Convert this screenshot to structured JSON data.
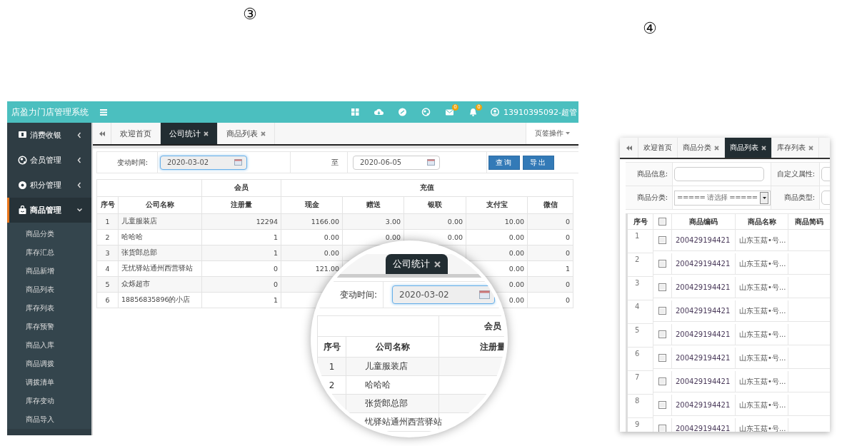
{
  "company_stats_screen": {
    "number": "③",
    "app_title": "店盈力门店管理系统",
    "mail_badge": "0",
    "bell_badge": "0",
    "user": "13910395092-超管",
    "sidebar": [
      {
        "label": "消费收银",
        "kind": "cashier",
        "expanded": false,
        "selected": false
      },
      {
        "label": "会员管理",
        "kind": "member",
        "expanded": false,
        "selected": false
      },
      {
        "label": "积分管理",
        "kind": "points",
        "expanded": false,
        "selected": false
      },
      {
        "label": "商品管理",
        "kind": "goods",
        "expanded": true,
        "selected": true,
        "children": [
          {
            "label": "商品分类"
          },
          {
            "label": "库存汇总"
          },
          {
            "label": "商品新增"
          },
          {
            "label": "商品列表"
          },
          {
            "label": "库存列表"
          },
          {
            "label": "库存预警"
          },
          {
            "label": "商品入库"
          },
          {
            "label": "商品调拨"
          },
          {
            "label": "调拨清单"
          },
          {
            "label": "库存变动"
          },
          {
            "label": "商品导入"
          }
        ]
      }
    ],
    "tabs": [
      {
        "label": "欢迎首页",
        "selected": false,
        "closable": false
      },
      {
        "label": "公司统计",
        "selected": true,
        "closable": true
      },
      {
        "label": "商品列表",
        "selected": false,
        "closable": true
      }
    ],
    "tab_menu": "页签操作",
    "filter": {
      "label": "变动时间:",
      "from": {
        "value": "2020-03-02",
        "focused": true
      },
      "to_label": "至",
      "to": {
        "value": "2020-06-05",
        "focused": false
      }
    },
    "buttons": [
      "查询",
      "导出"
    ],
    "table": {
      "header_groups": [
        {
          "columns": [
            {
              "label": "序号"
            },
            {
              "label": "公司名称"
            }
          ]
        },
        {
          "label": "会员",
          "columns": [
            {
              "label": "注册量"
            }
          ]
        },
        {
          "label": "充值",
          "columns": [
            {
              "label": "现金"
            },
            {
              "label": "赠送"
            },
            {
              "label": "银联"
            },
            {
              "label": "支付宝"
            },
            {
              "label": "微信"
            }
          ]
        }
      ],
      "rows": [
        {
          "cells": [
            "1",
            "儿童服装店",
            "12294",
            "1166.00",
            "3.00",
            "0.00",
            "10.00",
            "0"
          ]
        },
        {
          "cells": [
            "2",
            "哈哈哈",
            "1",
            "0.00",
            "0.00",
            "0.00",
            "0.00",
            "0"
          ]
        },
        {
          "cells": [
            "3",
            "张货郎总部",
            "1",
            "0.00",
            null,
            null,
            "0.00",
            "0"
          ]
        },
        {
          "cells": [
            "4",
            "无忧驿站通州西营驿站",
            "0",
            "121.00",
            null,
            null,
            "0.00",
            "1"
          ]
        },
        {
          "cells": [
            "5",
            "众烁超市",
            "0",
            null,
            null,
            null,
            "0.00",
            "0"
          ]
        },
        {
          "cells": [
            "6",
            "18856835896的小店",
            "1",
            null,
            null,
            null,
            "0.00",
            "0"
          ]
        }
      ]
    },
    "magnifier": {
      "tab": {
        "label": "公司统计",
        "selected": true,
        "closable": true
      },
      "filter_label": "变动时间:",
      "date": "2020-03-02",
      "group_header": "会员",
      "columns": [
        "序号",
        "公司名称",
        "注册量"
      ],
      "rows": [
        {
          "cells": [
            "1",
            "儿童服装店"
          ]
        },
        {
          "cells": [
            "2",
            "哈哈哈"
          ]
        },
        {
          "cells": [
            null,
            "张货郎总部"
          ]
        },
        {
          "cells": [
            null,
            "忧驿站通州西营驿站"
          ]
        }
      ]
    }
  },
  "product_list_screen": {
    "number": "④",
    "tabs": [
      {
        "label": "欢迎首页",
        "selected": false,
        "closable": false
      },
      {
        "label": "商品分类",
        "selected": false,
        "closable": true
      },
      {
        "label": "商品列表",
        "selected": true,
        "closable": true
      },
      {
        "label": "库存列表",
        "selected": false,
        "closable": true
      }
    ],
    "filter_rows": [
      [
        {
          "label": "商品信息:",
          "field": {
            "kind": "text"
          }
        },
        {
          "label": "自定义属性:",
          "field": {
            "kind": "text"
          }
        }
      ],
      [
        {
          "label": "商品分类:",
          "field": {
            "kind": "select",
            "value": "===== 请选择 ====="
          }
        },
        {
          "label": "商品类型:",
          "field": {
            "kind": "text"
          }
        }
      ]
    ],
    "columns": [
      {
        "kind": "text",
        "label": "序号"
      },
      {
        "kind": "checkbox",
        "checked": false
      },
      {
        "kind": "text",
        "label": "商品编码"
      },
      {
        "kind": "text",
        "label": "商品名称"
      },
      {
        "kind": "text",
        "label": "商品简码"
      }
    ],
    "rows": [
      {
        "index": "1",
        "checked": false,
        "code": "200429194421",
        "name": "山东玉菇•号..."
      },
      {
        "index": "2",
        "checked": false,
        "code": "200429194421",
        "name": "山东玉菇•号..."
      },
      {
        "index": "3",
        "checked": false,
        "code": "200429194421",
        "name": "山东玉菇•号..."
      },
      {
        "index": "4",
        "checked": false,
        "code": "200429194421",
        "name": "山东玉菇•号..."
      },
      {
        "index": "5",
        "checked": false,
        "code": "200429194421",
        "name": "山东玉菇•号..."
      },
      {
        "index": "6",
        "checked": false,
        "code": "200429194421",
        "name": "山东玉菇•号..."
      },
      {
        "index": "7",
        "checked": false,
        "code": "200429194421",
        "name": "山东玉菇•号..."
      },
      {
        "index": "8",
        "checked": false,
        "code": "200429194421",
        "name": "山东玉菇•号..."
      },
      {
        "index": "9",
        "checked": false,
        "code": "200429194421",
        "name": "山东玉菇•号..."
      }
    ]
  }
}
